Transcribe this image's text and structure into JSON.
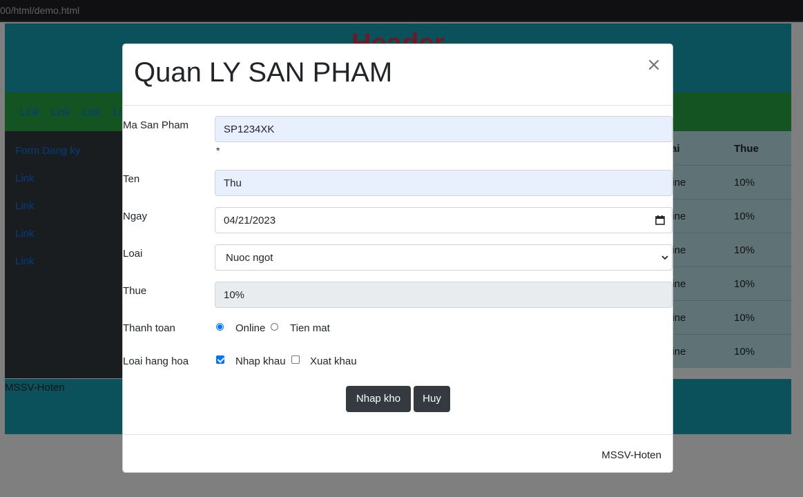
{
  "browser": {
    "url": "00/html/demo.html"
  },
  "page": {
    "header_title": "Header",
    "nav_links": [
      "Link",
      "Link",
      "Link",
      "Li"
    ],
    "sidebar_links": [
      "Form Dang ky",
      "Link",
      "Link",
      "Link",
      "Link"
    ],
    "table": {
      "headers": [
        "ai",
        "Thue"
      ],
      "rows": [
        [
          "line",
          "10%"
        ],
        [
          "line",
          "10%"
        ],
        [
          "line",
          "10%"
        ],
        [
          "line",
          "10%"
        ],
        [
          "line",
          "10%"
        ],
        [
          "line",
          "10%"
        ]
      ]
    },
    "footer_text": "MSSV-Hoten"
  },
  "modal": {
    "title": "Quan LY SAN PHAM",
    "close_symbol": "×",
    "fields": {
      "ma_san_pham": {
        "label": "Ma San Pham",
        "value": "SP1234XK",
        "required_mark": "*"
      },
      "ten": {
        "label": "Ten",
        "value": "Thu"
      },
      "ngay": {
        "label": "Ngay",
        "value": "04/21/2023"
      },
      "loai": {
        "label": "Loai",
        "selected": "Nuoc ngot"
      },
      "thue": {
        "label": "Thue",
        "value": "10%"
      },
      "thanh_toan": {
        "label": "Thanh toan",
        "options": [
          "Online",
          "Tien mat"
        ],
        "selected": "Online"
      },
      "loai_hang_hoa": {
        "label": "Loai hang hoa",
        "options": [
          "Nhap khau",
          "Xuat khau"
        ],
        "checked": [
          "Nhap khau"
        ]
      }
    },
    "buttons": {
      "submit": "Nhap kho",
      "cancel": "Huy"
    },
    "footer_text": "MSSV-Hoten"
  }
}
